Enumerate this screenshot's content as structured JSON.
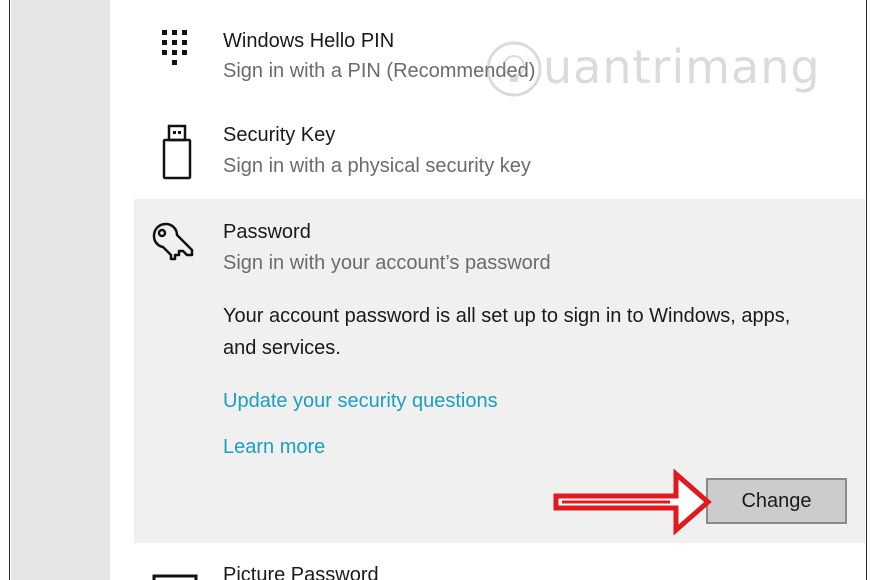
{
  "sign_in_options": {
    "hello_pin": {
      "title": "Windows Hello PIN",
      "subtitle": "Sign in with a PIN (Recommended)",
      "icon": "keypad-icon"
    },
    "security_key": {
      "title": "Security Key",
      "subtitle": "Sign in with a physical security key",
      "icon": "usb-key-icon"
    },
    "password": {
      "title": "Password",
      "subtitle": "Sign in with your account’s password",
      "icon": "key-icon",
      "description": "Your account password is all set up to sign in to Windows, apps, and services.",
      "update_link": "Update your security questions",
      "learn_more_link": "Learn more",
      "change_button": "Change"
    },
    "picture_password": {
      "title": "Picture Password",
      "icon": "picture-icon"
    }
  },
  "watermark": {
    "text": "uantrimang"
  },
  "colors": {
    "link": "#1a9fc0",
    "panel": "#f0f0f0",
    "sidebar": "#e6e6e6",
    "annotation_arrow": "#e0191f"
  }
}
